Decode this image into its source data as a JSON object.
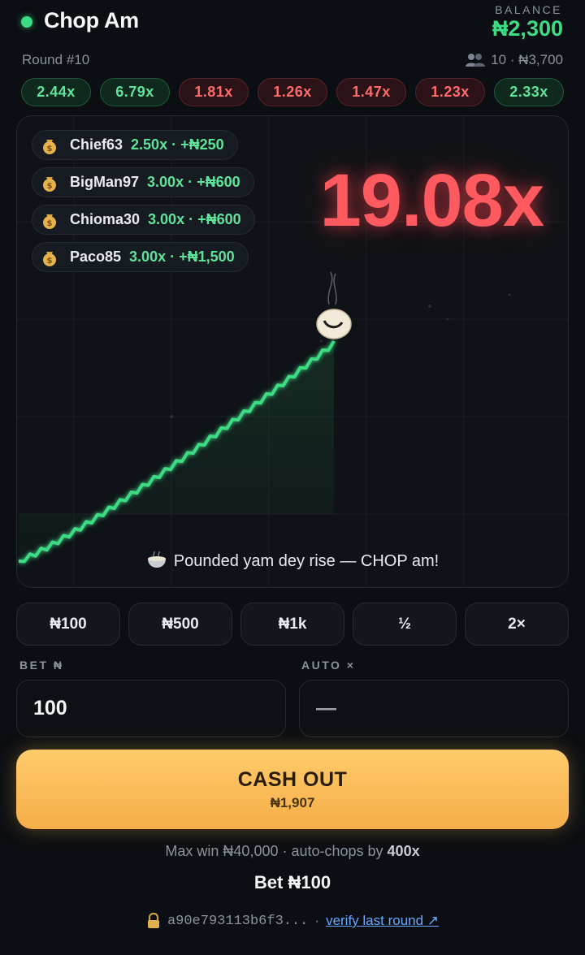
{
  "header": {
    "app_title": "Chop Am",
    "balance_label": "BALANCE",
    "balance_value": "₦2,300",
    "status_color": "#3ddc84"
  },
  "round": {
    "label": "Round #10",
    "players_icon": "users-icon",
    "players_info": "10 · ₦3,700"
  },
  "history": [
    {
      "value": "2.44x",
      "status": "green"
    },
    {
      "value": "6.79x",
      "status": "green"
    },
    {
      "value": "1.81x",
      "status": "red"
    },
    {
      "value": "1.26x",
      "status": "red"
    },
    {
      "value": "1.47x",
      "status": "red"
    },
    {
      "value": "1.23x",
      "status": "red"
    },
    {
      "value": "2.33x",
      "status": "green"
    }
  ],
  "game": {
    "multiplier": "19.08x",
    "message": "Pounded yam dey rise — CHOP am!",
    "message_icon": "bowl-icon",
    "line_color": "#3ddc84",
    "multiplier_color": "#ff5a5f",
    "cashouts": [
      {
        "name": "Chief63",
        "win": "2.50x · +₦250",
        "icon": "moneybag-icon"
      },
      {
        "name": "BigMan97",
        "win": "3.00x · +₦600",
        "icon": "moneybag-icon"
      },
      {
        "name": "Chioma30",
        "win": "3.00x · +₦600",
        "icon": "moneybag-icon"
      },
      {
        "name": "Paco85",
        "win": "3.00x · +₦1,500",
        "icon": "moneybag-icon"
      }
    ]
  },
  "quick_bets": [
    "₦100",
    "₦500",
    "₦1k",
    "½",
    "2×"
  ],
  "bet_field": {
    "label": "BET ₦",
    "value": "100"
  },
  "auto_field": {
    "label": "AUTO ×",
    "value": "—"
  },
  "cashout": {
    "label": "CASH OUT",
    "amount": "₦1,907",
    "color": "#f6ae49"
  },
  "footer": {
    "max_win_prefix": "Max win ₦40,000 · auto-chops by ",
    "max_win_strong": "400x",
    "bet_line": "Bet ₦100",
    "hash": "a90e793113b6f3...",
    "separator": "·",
    "verify_link": "verify last round ↗",
    "lock_icon": "lock-icon"
  }
}
